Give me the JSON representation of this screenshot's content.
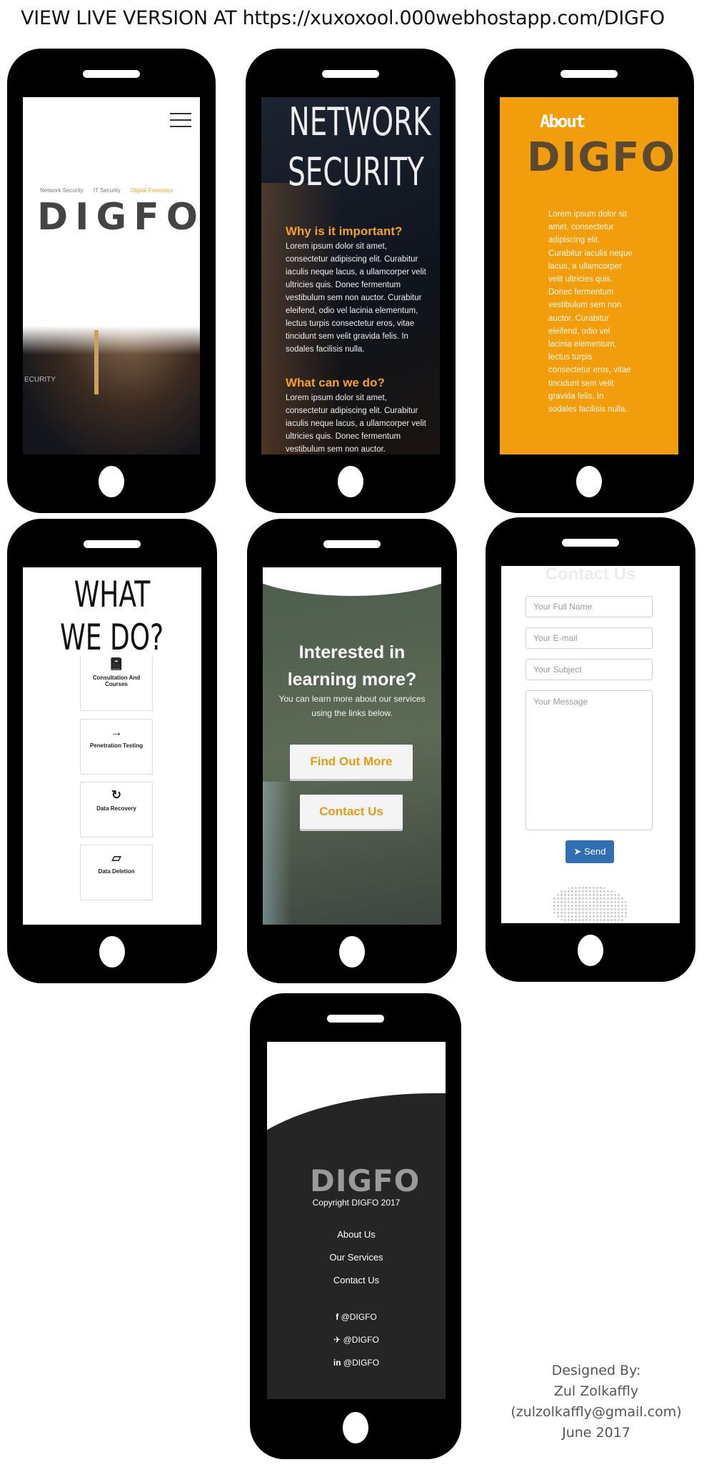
{
  "banner": "VIEW LIVE VERSION AT https://xuxoxool.000webhostapp.com/DIGFO",
  "logo": "DIGFO",
  "screen1": {
    "nav": [
      "Network Security",
      "IT Security",
      "Digital Forensics"
    ],
    "photo_text": "ECURITY"
  },
  "screen2": {
    "title_line1": "NETWORK",
    "title_line2": "SECURITY",
    "heading1": "Why is it important?",
    "body1": "Lorem ipsum dolor sit amet, consectetur adipiscing elit. Curabitur iaculis neque lacus, a ullamcorper velit ultricies quis. Donec fermentum vestibulum sem non auctor. Curabitur eleifend, odio vel lacinia elementum, lectus turpis consectetur eros, vitae tincidunt sem velit gravida felis. In sodales facilisis nulla.",
    "heading2": "What can we do?",
    "body2": "Lorem ipsum dolor sit amet, consectetur adipiscing elit. Curabitur iaculis neque lacus, a ullamcorper velit ultricies quis. Donec fermentum vestibulum sem non auctor."
  },
  "screen3": {
    "about": "About",
    "body": "Lorem ipsum dolor sit amet, consectetur adipiscing elit. Curabitur iaculis neque lacus, a ullamcorper velit ultricies quis. Donec fermentum vestibulum sem non auctor. Curabitur eleifend, odio vel lacinia elementum, lectus turpis consectetur eros, vitae tincidunt sem velit gravida felis. In sodales facilisis nulla."
  },
  "screen4": {
    "title_line1": "WHAT",
    "title_line2": "WE DO?",
    "services": [
      {
        "label": "Consultation And Courses",
        "icon": "book-icon"
      },
      {
        "label": "Penetration Testing",
        "icon": "arrow-right-icon"
      },
      {
        "label": "Data Recovery",
        "icon": "undo-icon"
      },
      {
        "label": "Data Deletion",
        "icon": "eraser-icon"
      }
    ]
  },
  "screen5": {
    "heading": "Interested in learning more?",
    "sub": "You can learn more about our services using the links below.",
    "find_out_more": "Find Out More",
    "contact_us": "Contact Us"
  },
  "screen6": {
    "title": "Contact Us",
    "placeholder_name": "Your Full Name",
    "placeholder_email": "Your E-mail",
    "placeholder_subject": "Your Subject",
    "placeholder_message": "Your Message",
    "send": "Send"
  },
  "screen7": {
    "copyright": "Copyright DIGFO 2017",
    "links": [
      "About Us",
      "Our Services",
      "Contact Us"
    ],
    "social": [
      "@DIGFO",
      "@DIGFO",
      "@DIGFO"
    ]
  },
  "credit": {
    "line1": "Designed By:",
    "line2": "Zul Zolkaffly",
    "line3": "(zulzolkaffly@gmail.com)",
    "line4": "June 2017"
  },
  "colors": {
    "accent": "#f4a21c",
    "about_bg": "#f29e0c",
    "send_button": "#2f6fb2",
    "footer_bg": "#252525"
  }
}
